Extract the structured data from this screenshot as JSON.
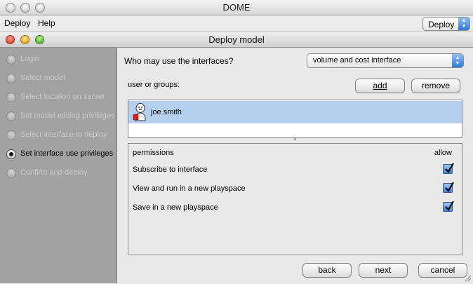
{
  "outer_window": {
    "title": "DOME",
    "menus": [
      "Deploy",
      "Help"
    ],
    "mode_select": "Deploy"
  },
  "dialog": {
    "title": "Deploy model",
    "steps": [
      {
        "label": "Login",
        "active": false
      },
      {
        "label": "Select model",
        "active": false
      },
      {
        "label": "Select location on server",
        "active": false
      },
      {
        "label": "Set model editing privileges",
        "active": false
      },
      {
        "label": "Select interface to deploy",
        "active": false
      },
      {
        "label": "Set interface use privileges",
        "active": true
      },
      {
        "label": "Confirm and deploy",
        "active": false
      }
    ],
    "question": "Who may use the interfaces?",
    "interface_select": "volume and cost interface",
    "users_label": "user or groups:",
    "add_button": "add",
    "remove_button": "remove",
    "users": [
      {
        "name": "joe smith"
      }
    ],
    "permissions_header": "permissions",
    "allow_header": "allow",
    "permissions": [
      {
        "label": "Subscribe to interface",
        "allowed": true
      },
      {
        "label": "View and run in a new playspace",
        "allowed": true
      },
      {
        "label": "Save in a new playspace",
        "allowed": true
      }
    ],
    "back_button": "back",
    "next_button": "next",
    "cancel_button": "cancel"
  },
  "colors": {
    "selection": "#b5d0ee",
    "sidebar": "#a2a2a2",
    "accent": "#3f7fd2"
  }
}
